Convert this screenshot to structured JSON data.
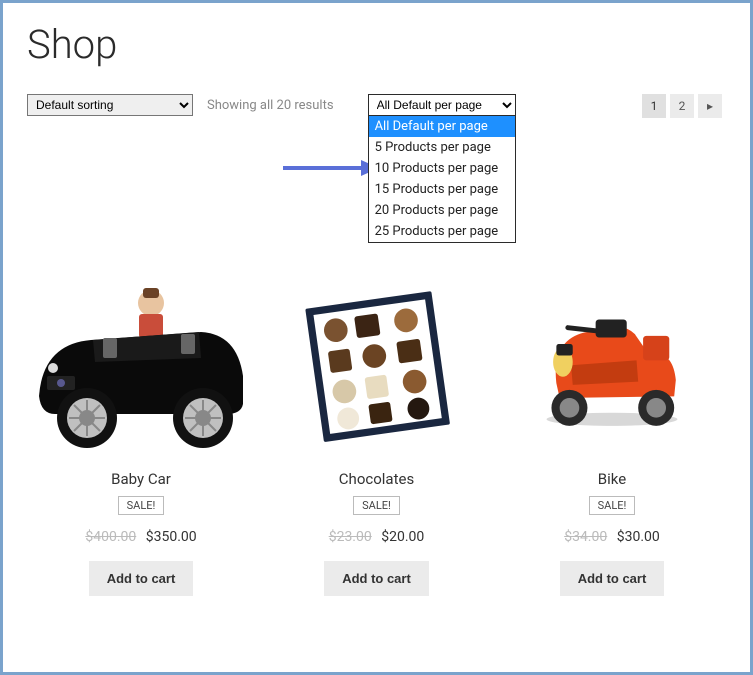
{
  "title": "Shop",
  "controls": {
    "sort_label": "Default sorting",
    "result_count": "Showing all 20 results",
    "perpage_selected": "All Default per page",
    "perpage_options": [
      "All Default per page",
      "5 Products per page",
      "10 Products per page",
      "15 Products per page",
      "20 Products per page",
      "25 Products per page"
    ]
  },
  "pagination": {
    "pages": [
      "1",
      "2"
    ],
    "next_icon": "▸"
  },
  "sale_label": "SALE!",
  "add_label": "Add to cart",
  "products": [
    {
      "title": "Baby Car",
      "old_price": "$400.00",
      "new_price": "$350.00"
    },
    {
      "title": "Chocolates",
      "old_price": "$23.00",
      "new_price": "$20.00"
    },
    {
      "title": "Bike",
      "old_price": "$34.00",
      "new_price": "$30.00"
    }
  ],
  "colors": {
    "arrow": "#5a6fd8"
  }
}
